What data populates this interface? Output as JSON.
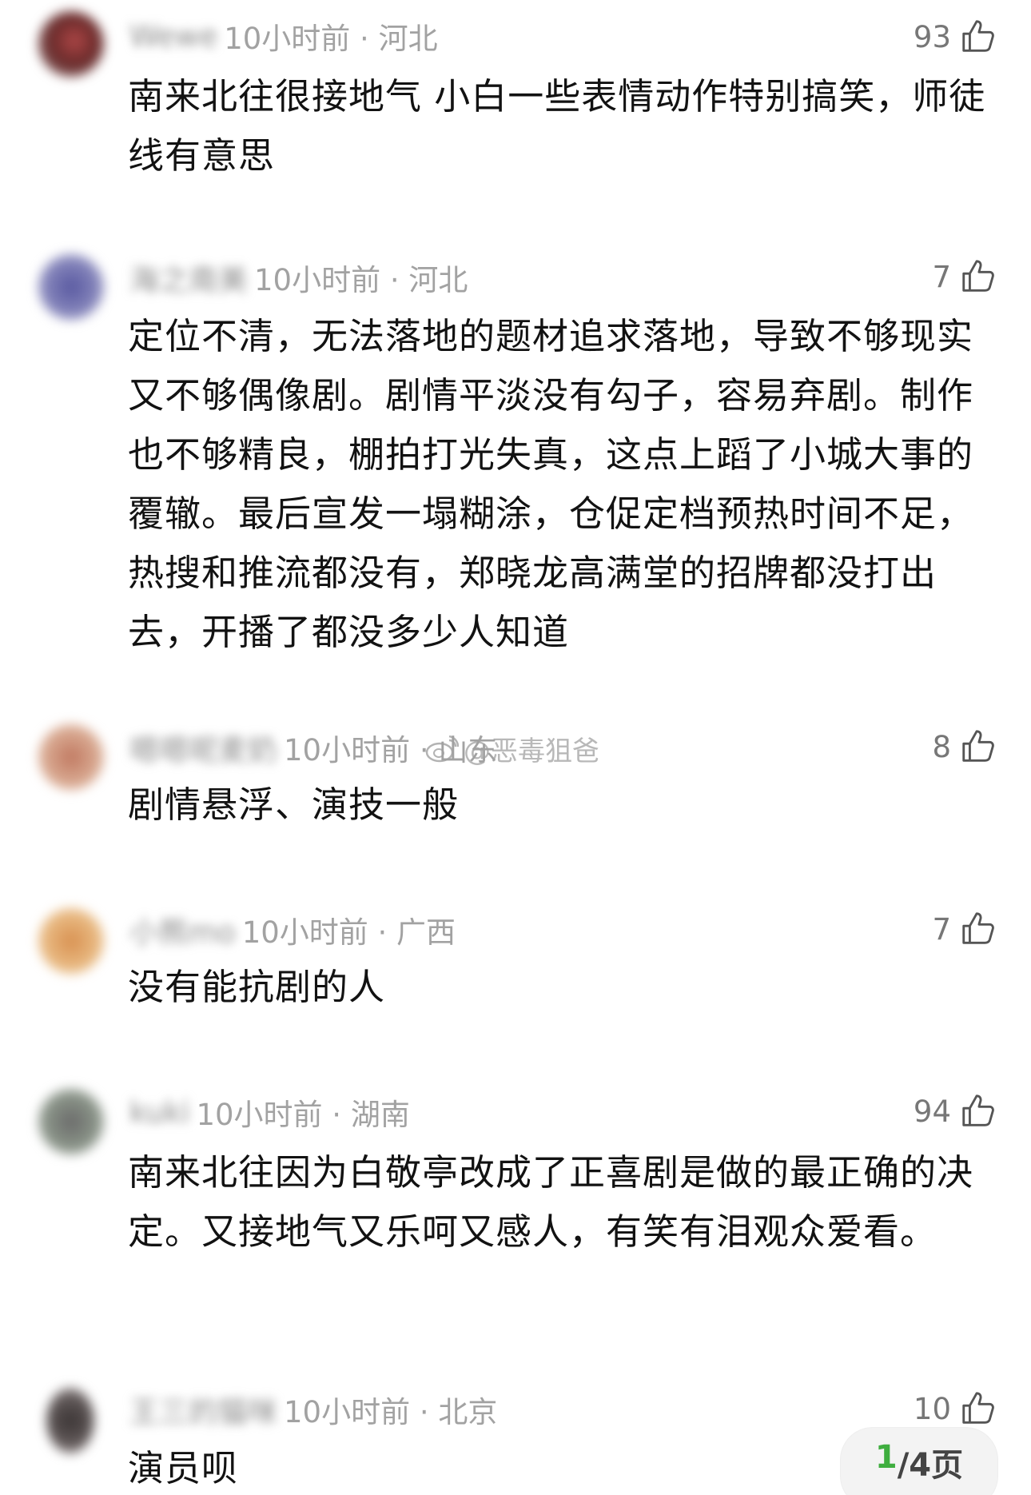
{
  "comments": [
    {
      "username": "Wewe",
      "time_location": "10小时前 · 河北",
      "likes": "93",
      "text": "南来北往很接地气 小白一些表情动作特别搞笑，师徒线有意思",
      "avatar_color": "#8a3a3a"
    },
    {
      "username": "海之南美",
      "time_location": "10小时前 · 河北",
      "likes": "7",
      "text": "定位不清，无法落地的题材追求落地，导致不够现实又不够偶像剧。剧情平淡没有勾子，容易弃剧。制作也不够精良，棚拍打光失真，这点上蹈了小城大事的覆辙。最后宣发一塌糊涂，仓促定档预热时间不足，热搜和推流都没有，郑晓龙高满堂的招牌都没打出去，开播了都没多少人知道",
      "avatar_color": "#6a6aa0"
    },
    {
      "username": "嗯嗯呢麦奶",
      "time_location": "10小时前 · 山东",
      "likes": "8",
      "text": "剧情悬浮、演技一般",
      "avatar_color": "#c89070"
    },
    {
      "username": "小熊mo",
      "time_location": "10小时前 · 广西",
      "likes": "7",
      "text": "没有能抗剧的人",
      "avatar_color": "#d8a060"
    },
    {
      "username": "kuki",
      "time_location": "10小时前 · 湖南",
      "likes": "94",
      "text": "南来北往因为白敬亭改成了正喜剧是做的最正确的决定。又接地气又乐呵又感人，有笑有泪观众爱看。",
      "avatar_color": "#707a70"
    },
    {
      "username": "王三的猫咪",
      "time_location": "10小时前 · 北京",
      "likes": "10",
      "text": "演员呗",
      "avatar_color": "#504848"
    }
  ],
  "watermark": {
    "text": "@恶毒狙爸"
  },
  "pager": {
    "current": "1",
    "rest": "/4页"
  },
  "colors": {
    "accent_green": "#3fae3f",
    "meta_gray": "#a2a2a2"
  },
  "icons": {
    "like": "thumbs-up-icon",
    "weibo": "weibo-logo-icon"
  }
}
